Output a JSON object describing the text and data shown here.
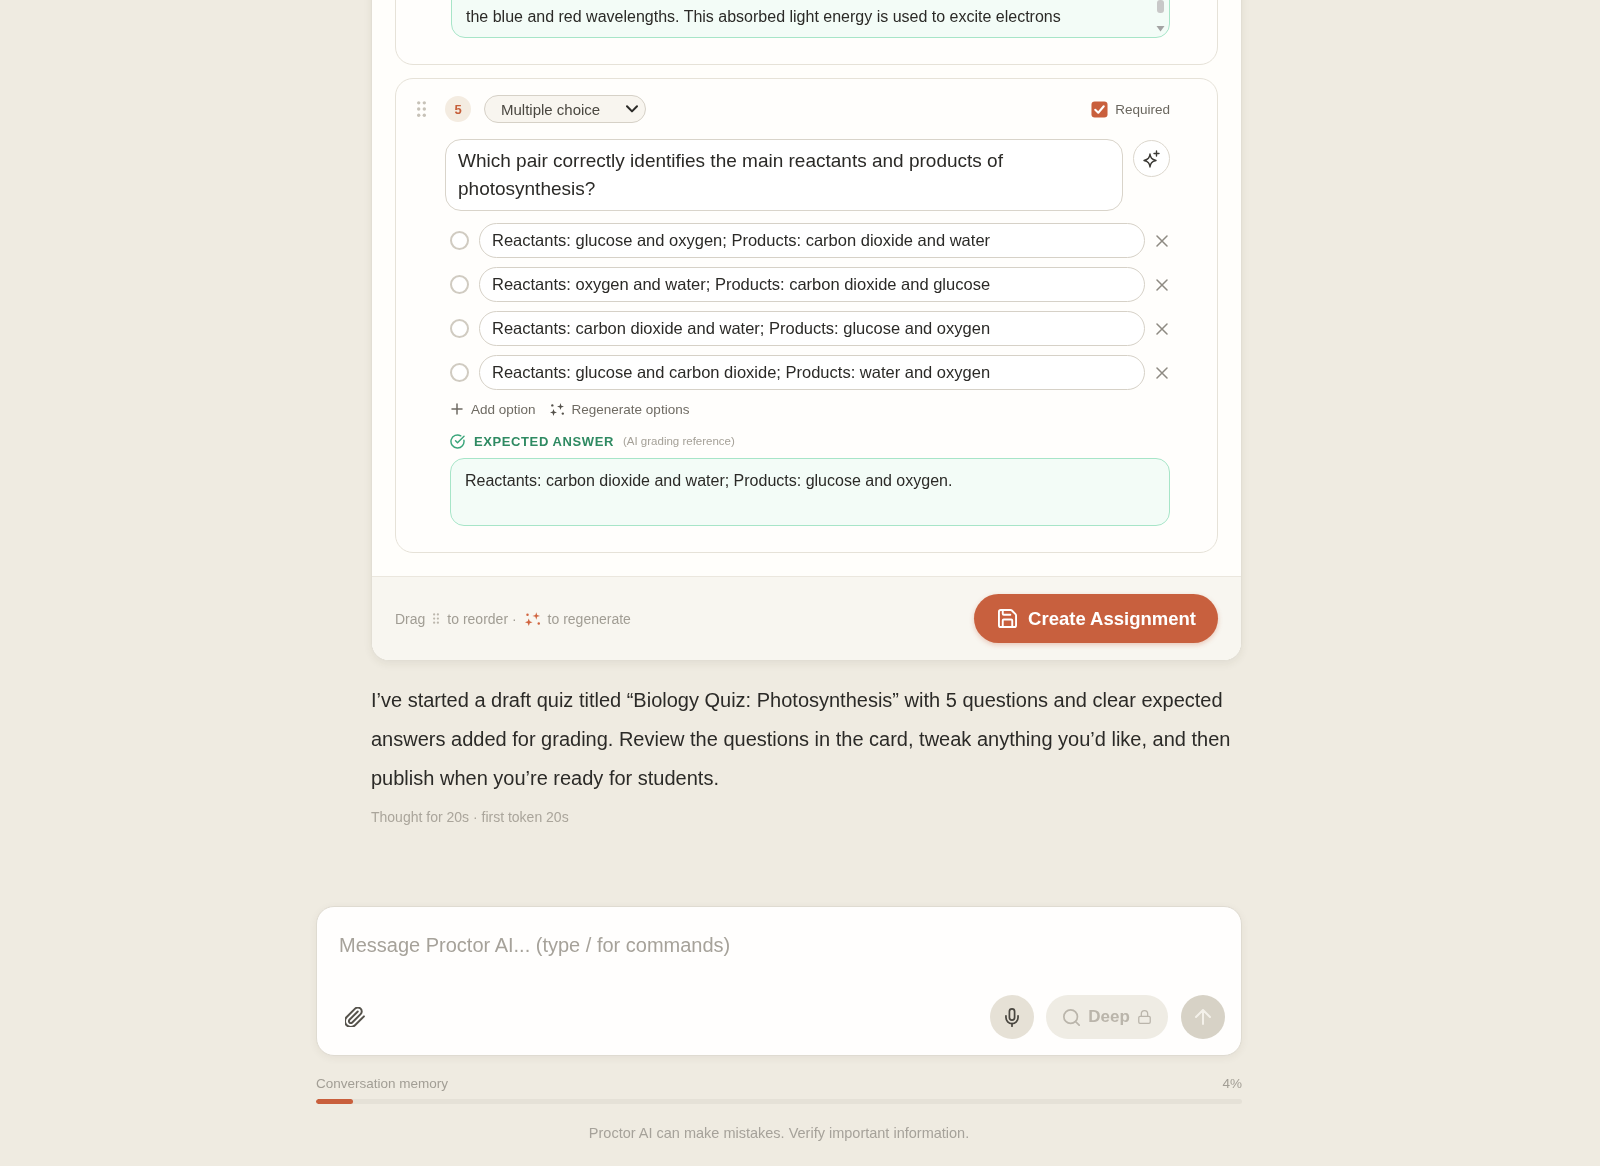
{
  "previous_question": {
    "expected_answer": "the blue and red wavelengths. This absorbed light energy is used to excite electrons"
  },
  "question": {
    "number": "5",
    "type": "Multiple choice",
    "required": true,
    "required_label": "Required",
    "text": "Which pair correctly identifies the main reactants and products of photosynthesis?",
    "options": [
      {
        "text": "Reactants: glucose and oxygen; Products: carbon dioxide and water",
        "selected": false
      },
      {
        "text": "Reactants: oxygen and water; Products: carbon dioxide and glucose",
        "selected": false
      },
      {
        "text": "Reactants: carbon dioxide and water; Products: glucose and oxygen",
        "selected": false
      },
      {
        "text": "Reactants: glucose and carbon dioxide; Products: water and oxygen",
        "selected": false
      }
    ],
    "add_option": "Add option",
    "regenerate_options": "Regenerate options",
    "expected_answer_label": "EXPECTED ANSWER",
    "expected_answer_note": "(AI grading reference)",
    "expected_answer": "Reactants: carbon dioxide and water; Products: glucose and oxygen."
  },
  "card_footer": {
    "hint": [
      "Drag",
      "to reorder ·",
      "to regenerate"
    ],
    "button": "Create Assignment"
  },
  "assistant_message": {
    "text": "I’ve started a draft quiz titled “Biology Quiz: Photosynthesis” with 5 questions and clear expected answers added for grading. Review the questions in the card, tweak anything you’d like, and then publish when you’re ready for students.",
    "meta": "Thought for 20s · first token 20s"
  },
  "composer": {
    "placeholder": "Message Proctor AI... (type / for commands)",
    "mode_button": {
      "label": "Deep",
      "locked": true
    },
    "send_button": {
      "disabled": true
    }
  },
  "memory": {
    "label": "Conversation memory",
    "reading": "4%",
    "level": 0.04
  },
  "disclaimer": "Proctor AI can make mistakes. Verify important information."
}
